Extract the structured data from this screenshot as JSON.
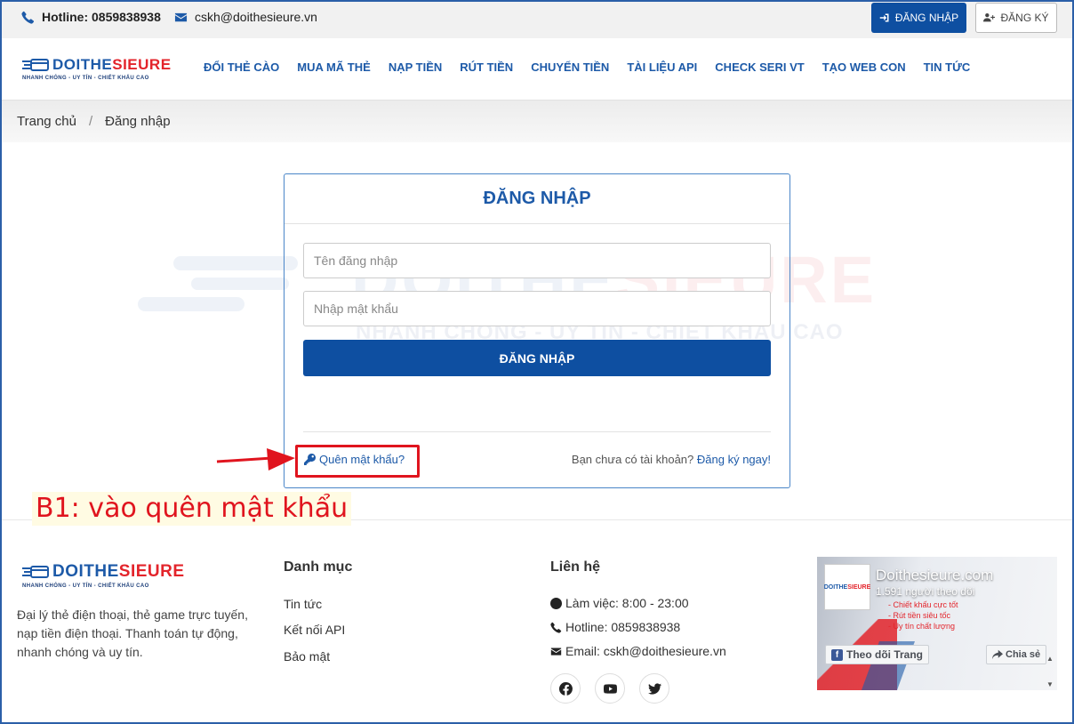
{
  "topbar": {
    "hotline": "Hotline: 0859838938",
    "email": "cskh@doithesieure.vn",
    "login_label": "ĐĂNG NHẬP",
    "register_label": "ĐĂNG KÝ"
  },
  "brand": {
    "name_a": "DOITHE",
    "name_b": "SIEURE",
    "slogan": "NHANH CHÓNG - UY TÍN - CHIẾT KHẤU CAO",
    "color_primary": "#1d5aa8",
    "color_accent": "#e3242b"
  },
  "nav": {
    "items": [
      "ĐỔI THẺ CÀO",
      "MUA MÃ THẺ",
      "NẠP TIỀN",
      "RÚT TIỀN",
      "CHUYỂN TIỀN",
      "TÀI LIỆU API",
      "CHECK SERI VT",
      "TẠO WEB CON",
      "TIN TỨC"
    ]
  },
  "breadcrumb": {
    "home": "Trang chủ",
    "sep": "/",
    "current": "Đăng nhập"
  },
  "login": {
    "title": "ĐĂNG NHẬP",
    "username_placeholder": "Tên đăng nhập",
    "password_placeholder": "Nhập mật khẩu",
    "submit_label": "ĐĂNG NHẬP",
    "forgot_label": "Quên mật khẩu?",
    "no_account_text": "Bạn chưa có tài khoản?",
    "register_link": "Đăng ký ngay!"
  },
  "annotation": {
    "text": "B1: vào quên mật khẩu",
    "color": "#e0141e"
  },
  "footer": {
    "description": "Đại lý thẻ điện thoại, thẻ game trực tuyến, nạp tiền điện thoại. Thanh toán tự động, nhanh chóng và uy tín.",
    "categories_title": "Danh mục",
    "categories": [
      "Tin tức",
      "Kết nối API",
      "Bảo mật"
    ],
    "contact_title": "Liên hệ",
    "hours": "Làm việc: 8:00 - 23:00",
    "hotline": "Hotline: 0859838938",
    "email": "Email: cskh@doithesieure.vn",
    "social_icons": [
      "facebook-icon",
      "youtube-icon",
      "twitter-icon"
    ]
  },
  "fb_widget": {
    "page_name": "Doithesieure.com",
    "followers": "1.591 người theo dõi",
    "bullets": [
      "- Chiết khấu cực tốt",
      "- Rút tiền siêu tốc",
      "- Uy tín chất lượng"
    ],
    "follow_label": "Theo dõi Trang",
    "share_label": "Chia sẻ"
  }
}
